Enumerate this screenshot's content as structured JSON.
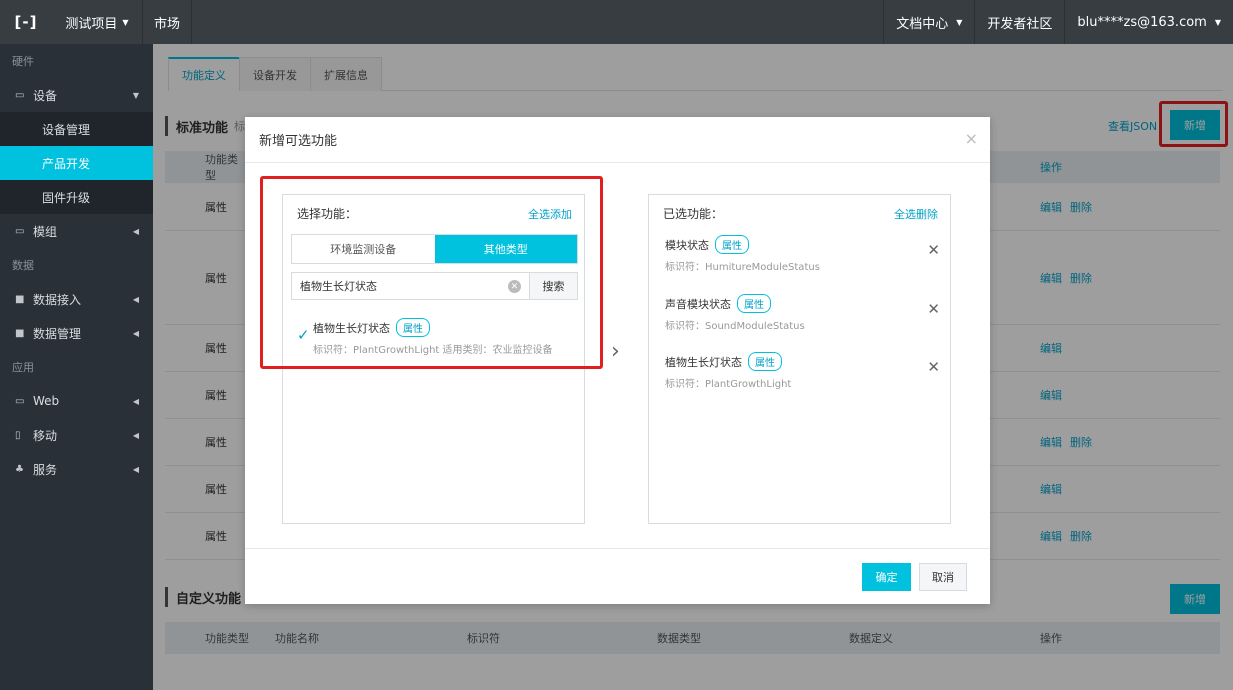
{
  "topbar": {
    "logo": "[-]",
    "project": "测试项目",
    "market": "市场",
    "docs": "文档中心",
    "community": "开发者社区",
    "user": "blu****zs@163.com"
  },
  "sidebar": {
    "group_hardware": "硬件",
    "device": "设备",
    "device_mgmt": "设备管理",
    "product_dev": "产品开发",
    "firmware": "固件升级",
    "module": "模组",
    "group_data": "数据",
    "data_access": "数据接入",
    "data_mgmt": "数据管理",
    "group_app": "应用",
    "web": "Web",
    "mobile": "移动",
    "service": "服务"
  },
  "main": {
    "tabs": [
      "功能定义",
      "设备开发",
      "扩展信息"
    ],
    "std_title": "标准功能",
    "std_sub": "标",
    "view_json": "查看JSON",
    "new_label": "新增",
    "col_type": "功能类型",
    "col_op": "操作",
    "row_type": "属性",
    "op_edit": "编辑",
    "op_delete": "删除",
    "custom_title": "自定义功能",
    "custom_new": "新增",
    "custom_cols": [
      "功能类型",
      "功能名称",
      "标识符",
      "数据类型",
      "数据定义",
      "操作"
    ]
  },
  "modal": {
    "title": "新增可选功能",
    "close": "×",
    "left": {
      "title": "选择功能：",
      "select_all": "全选添加",
      "seg_a": "环境监测设备",
      "seg_b": "其他类型",
      "search_value": "植物生长灯状态",
      "search_btn": "搜索",
      "option_name": "植物生长灯状态",
      "option_tag": "属性",
      "option_info": "标识符：PlantGrowthLight  适用类别：农业监控设备"
    },
    "right": {
      "title": "已选功能：",
      "remove_all": "全选删除",
      "items": [
        {
          "name": "模块状态",
          "tag": "属性",
          "id": "标识符：HumitureModuleStatus"
        },
        {
          "name": "声音模块状态",
          "tag": "属性",
          "id": "标识符：SoundModuleStatus"
        },
        {
          "name": "植物生长灯状态",
          "tag": "属性",
          "id": "标识符：PlantGrowthLight"
        }
      ]
    },
    "ok": "确定",
    "cancel": "取消"
  }
}
